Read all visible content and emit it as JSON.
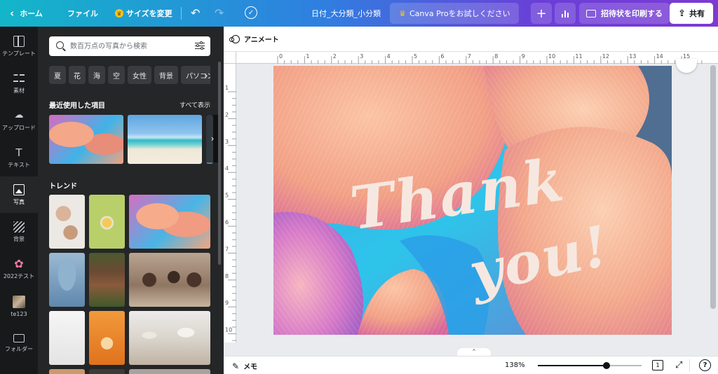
{
  "topbar": {
    "home_label": "ホーム",
    "file_label": "ファイル",
    "resize_label": "サイズを変更",
    "doc_name": "日付_大分類_小分類",
    "pro_label": "Canva Proをお試しください",
    "print_label": "招待状を印刷する",
    "share_label": "共有"
  },
  "rail": {
    "items": [
      {
        "label": "テンプレート",
        "icon": "template-icon"
      },
      {
        "label": "素材",
        "icon": "elements-icon"
      },
      {
        "label": "アップロード",
        "icon": "upload-icon"
      },
      {
        "label": "テキスト",
        "icon": "text-icon"
      },
      {
        "label": "写真",
        "icon": "photo-icon"
      },
      {
        "label": "背景",
        "icon": "background-icon"
      },
      {
        "label": "2022テスト",
        "icon": "flower-icon"
      },
      {
        "label": "te123",
        "icon": "thumbnail-icon"
      },
      {
        "label": "フォルダー",
        "icon": "folder-icon"
      }
    ],
    "active_index": 4
  },
  "panel": {
    "search_placeholder": "数百万点の写真から検索",
    "chips": [
      "夏",
      "花",
      "海",
      "空",
      "女性",
      "背景",
      "パソコン"
    ],
    "recent_title": "最近使用した項目",
    "see_all": "すべて表示",
    "trend_title": "トレンド"
  },
  "editor": {
    "animate_label": "アニメート",
    "ruler_h": [
      "0",
      "1",
      "2",
      "3",
      "4",
      "5",
      "6",
      "7",
      "8",
      "9",
      "10",
      "11",
      "12",
      "13",
      "14",
      "15"
    ],
    "ruler_v": [
      "1",
      "2",
      "3",
      "4",
      "5",
      "6",
      "7",
      "8",
      "9",
      "10"
    ],
    "canvas_text": {
      "line1": "Thank",
      "line2": "you!"
    }
  },
  "bottombar": {
    "memo_label": "メモ",
    "zoom": "138%",
    "zoom_level": 0.66,
    "page_count": "1",
    "help": "?"
  },
  "colors": {
    "topbar_gradient": [
      "#13b6c9",
      "#7c3ad3"
    ],
    "panel_bg": "#252627",
    "rail_bg": "#18191b",
    "canvas_bg": "#e9ebef"
  }
}
